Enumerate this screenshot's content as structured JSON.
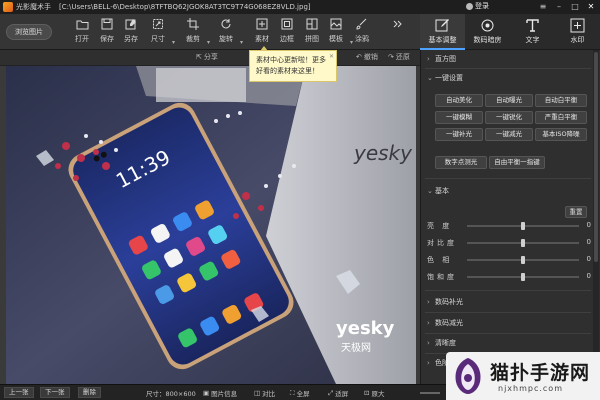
{
  "titlebar": {
    "app_title": "光影魔术手",
    "file_path": "[C:\\Users\\BELL-6\\Desktop\\8TFTBQ62JGOK8AT3TC9T74G068EZ8VLD.jpg]",
    "login_label": "登录"
  },
  "toolbar": {
    "browse_label": "浏览图片",
    "open_label": "打开",
    "save_label": "保存",
    "saveas_label": "另存",
    "size_label": "尺寸",
    "crop_label": "裁剪",
    "rotate_label": "旋转",
    "material_label": "素材",
    "border_label": "边框",
    "collage_label": "拼图",
    "template_label": "模板",
    "graffiti_label": "涂鸦"
  },
  "right_tabs": [
    {
      "label": "基本调整",
      "active": true
    },
    {
      "label": "数码暗房",
      "active": false
    },
    {
      "label": "文字",
      "active": false
    },
    {
      "label": "水印",
      "active": false
    }
  ],
  "subbar": {
    "share_label": "分享",
    "undo_label": "撤销",
    "redo_label": "还原"
  },
  "tooltip": {
    "line1": "素材中心更新啦！更多",
    "line2": "好看的素材来这里！"
  },
  "panel": {
    "histogram_label": "直方图",
    "onekey_label": "一键设置",
    "onekey_buttons": [
      "自动美化",
      "自动曝光",
      "自动白平衡",
      "一键模糊",
      "一键锐化",
      "严重白平衡",
      "一键补光",
      "一键减光",
      "基本ISO降噪",
      "数字点测光",
      "自由平衡一指键"
    ],
    "basic_label": "基本",
    "reset_label": "重置",
    "sliders": [
      {
        "label": "亮 度",
        "value": "0",
        "level": 0.5
      },
      {
        "label": "对比度",
        "value": "0",
        "level": 0.5
      },
      {
        "label": "色 相",
        "value": "0",
        "level": 0.5
      },
      {
        "label": "饱和度",
        "value": "0",
        "level": 0.5
      }
    ],
    "sections": [
      "数码补光",
      "数码减光",
      "清晰度",
      "色阶"
    ]
  },
  "bottombar": {
    "prev_label": "上一张",
    "next_label": "下一张",
    "delete_label": "删除",
    "size_text": "尺寸：800×600",
    "info_label": "图片信息",
    "compare_label": "对比",
    "fullscreen_label": "全屏",
    "fit_label": "适屏",
    "original_label": "原大"
  },
  "watermark": {
    "name": "猫扑手游网",
    "url": "njxhmpc.com"
  },
  "photo": {
    "phone_time": "11:39",
    "brand_main": "yesky",
    "brand_cn": "天极网"
  },
  "colors": {
    "accent": "#4da3ff",
    "tooltip_bg": "#fff9c9",
    "panel_bg": "#2f2f2f"
  }
}
